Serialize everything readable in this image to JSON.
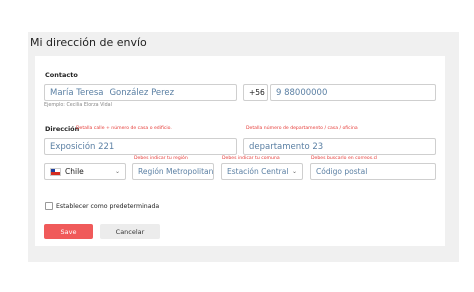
{
  "page_title": "Mi dirección de envío",
  "contact": {
    "section_label": "Contacto",
    "first_name": "María Teresa",
    "last_name": "González Perez",
    "example": "Ejemplo: Cecilia Elorza Vidal",
    "phone_prefix": "+56",
    "phone_number": "9 88000000"
  },
  "address": {
    "section_label": "Dirección",
    "street_hint": "Detalla calle + número de casa o edificio.",
    "apartment_hint": "Detalla número de departamento / casa / oficina",
    "street_value": "Exposición 221",
    "apartment_value": "departamento 23",
    "region_hint": "Debes indicar tu región",
    "comuna_hint": "Debes indicar tu comuna",
    "postal_hint": "Debes buscarlo en correos.cl",
    "country_value": "Chile",
    "region_value": "Región Metropolitana",
    "comuna_value": "Estación Central",
    "postal_placeholder": "Código postal"
  },
  "default_checkbox_label": "Establecer como predeterminada",
  "buttons": {
    "save": "Save",
    "cancel": "Cancelar"
  },
  "colors": {
    "accent": "#f05a5a",
    "hint_red": "#e53935",
    "field_text": "#5a7fa3"
  },
  "icons": {
    "flag": "chile-flag-icon",
    "dropdown": "chevron-down-icon"
  }
}
